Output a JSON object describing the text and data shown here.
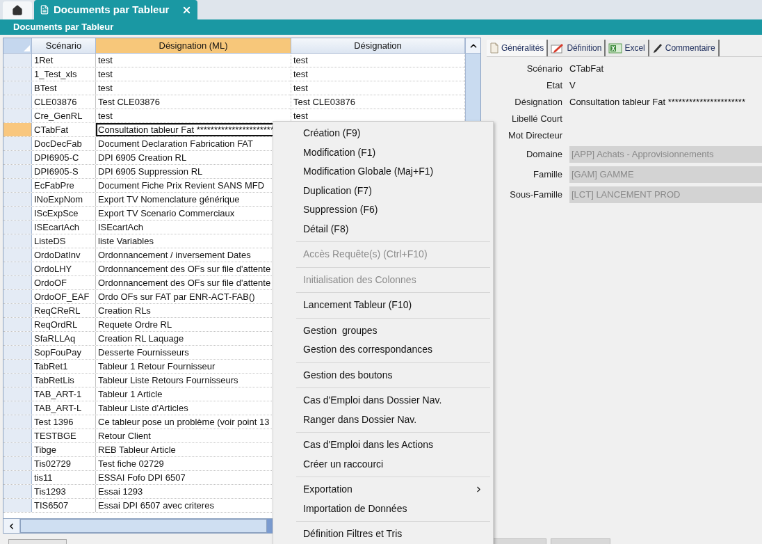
{
  "app_tabs": [
    {
      "kind": "home",
      "selected": false
    },
    {
      "kind": "document",
      "label": "Documents par Tableur",
      "selected": true
    }
  ],
  "title": "Documents par Tableur",
  "grid": {
    "columns": [
      {
        "label": "Scénario",
        "sorted": false
      },
      {
        "label": "Désignation (ML)",
        "sorted": true
      },
      {
        "label": "Désignation",
        "sorted": false
      }
    ],
    "rows": [
      {
        "scenario": "1Ret",
        "designation_ml": "test",
        "designation": "test",
        "selected": false
      },
      {
        "scenario": "1_Test_xls",
        "designation_ml": "test",
        "designation": "test",
        "selected": false
      },
      {
        "scenario": "BTest",
        "designation_ml": "test",
        "designation": "test",
        "selected": false
      },
      {
        "scenario": "CLE03876",
        "designation_ml": "Test CLE03876",
        "designation": "Test CLE03876",
        "selected": false
      },
      {
        "scenario": "Cre_GenRL",
        "designation_ml": "test",
        "designation": "test",
        "selected": false
      },
      {
        "scenario": "CTabFat",
        "designation_ml": "Consultation tableur Fat **********************",
        "selected": true
      },
      {
        "scenario": "DocDecFab",
        "designation_ml": "Document Declaration Fabrication FAT",
        "selected": false
      },
      {
        "scenario": "DPI6905-C",
        "designation_ml": "DPI 6905 Creation RL",
        "selected": false
      },
      {
        "scenario": "DPI6905-S",
        "designation_ml": "DPI 6905 Suppression RL",
        "selected": false
      },
      {
        "scenario": "EcFabPre",
        "designation_ml": "Document Fiche Prix Revient SANS MFD",
        "selected": false
      },
      {
        "scenario": "INoExpNom",
        "designation_ml": "Export TV Nomenclature générique",
        "selected": false
      },
      {
        "scenario": "IScExpSce",
        "designation_ml": "Export TV Scenario Commerciaux",
        "selected": false
      },
      {
        "scenario": "ISEcartAch",
        "designation_ml": "ISEcartAch",
        "selected": false
      },
      {
        "scenario": "ListeDS",
        "designation_ml": "liste Variables",
        "selected": false
      },
      {
        "scenario": "OrdoDatInv",
        "designation_ml": "Ordonnancement / inversement Dates",
        "selected": false
      },
      {
        "scenario": "OrdoLHY",
        "designation_ml": "Ordonnancement des OFs sur file d'attente",
        "selected": false
      },
      {
        "scenario": "OrdoOF",
        "designation_ml": "Ordonnancement des OFs sur file d'attente",
        "selected": false
      },
      {
        "scenario": "OrdoOF_EAF",
        "designation_ml": "Ordo OFs sur FAT par ENR-ACT-FAB()",
        "selected": false
      },
      {
        "scenario": "ReqCReRL",
        "designation_ml": "Creation RLs",
        "selected": false
      },
      {
        "scenario": "ReqOrdRL",
        "designation_ml": "Requete Ordre RL",
        "selected": false
      },
      {
        "scenario": "SfaRLLAq",
        "designation_ml": "Creation RL Laquage",
        "selected": false
      },
      {
        "scenario": "SopFouPay",
        "designation_ml": "Desserte Fournisseurs",
        "selected": false
      },
      {
        "scenario": "TabRet1",
        "designation_ml": "Tableur 1 Retour Fournisseur",
        "selected": false
      },
      {
        "scenario": "TabRetLis",
        "designation_ml": "Tableur Liste Retours Fournisseurs",
        "selected": false
      },
      {
        "scenario": "TAB_ART-1",
        "designation_ml": "Tableur 1 Article",
        "selected": false
      },
      {
        "scenario": "TAB_ART-L",
        "designation_ml": "Tableur Liste d'Articles",
        "selected": false
      },
      {
        "scenario": "Test 1396",
        "designation_ml": "Ce tableur pose un problème (voir point 13",
        "selected": false
      },
      {
        "scenario": "TESTBGE",
        "designation_ml": "Retour Client",
        "selected": false
      },
      {
        "scenario": "Tibge",
        "designation_ml": "REB Tableur Article",
        "selected": false
      },
      {
        "scenario": "Tis02729",
        "designation_ml": "Test fiche 02729",
        "selected": false
      },
      {
        "scenario": "tis11",
        "designation_ml": "ESSAI Fofo DPI 6507",
        "selected": false
      },
      {
        "scenario": "Tis1293",
        "designation_ml": "Essai 1293",
        "selected": false
      },
      {
        "scenario": "TIS6507",
        "designation_ml": "Essai DPI 6507 avec criteres",
        "selected": false
      }
    ]
  },
  "detail_tabs": [
    {
      "label": "Généralités",
      "selected": true
    },
    {
      "label": "Définition",
      "selected": false
    },
    {
      "label": "Excel",
      "selected": false
    },
    {
      "label": "Commentaire",
      "selected": false
    }
  ],
  "detail_fields": [
    {
      "kind": "text",
      "label": "Scénario",
      "value": "CTabFat"
    },
    {
      "kind": "text",
      "label": "Etat",
      "value": "V"
    },
    {
      "kind": "text",
      "label": "Désignation",
      "value": "Consultation tableur Fat **********************"
    },
    {
      "kind": "text",
      "label": "Libellé Court"
    },
    {
      "kind": "text",
      "label": "Mot Directeur"
    },
    {
      "kind": "select",
      "label": "Domaine",
      "value": "[APP] Achats - Approvisionnements",
      "disabled": true
    },
    {
      "kind": "select",
      "label": "Famille",
      "value": "[GAM] GAMME",
      "disabled": true
    },
    {
      "kind": "select",
      "label": "Sous-Famille",
      "value": "[LCT] LANCEMENT PROD",
      "disabled": true
    }
  ],
  "context_menu": {
    "groups": [
      [
        {
          "label": "Création (F9)",
          "disabled": false,
          "submenu": false
        },
        {
          "label": "Modification (F1)",
          "disabled": false,
          "submenu": false
        },
        {
          "label": "Modification Globale (Maj+F1)",
          "disabled": false,
          "submenu": false
        },
        {
          "label": "Duplication (F7)",
          "disabled": false,
          "submenu": false
        },
        {
          "label": "Suppression (F6)",
          "disabled": false,
          "submenu": false
        },
        {
          "label": "Détail (F8)",
          "disabled": false,
          "submenu": false
        }
      ],
      [
        {
          "label": "Accès Requête(s) (Ctrl+F10)",
          "disabled": true,
          "submenu": false
        }
      ],
      [
        {
          "label": "Initialisation des Colonnes",
          "disabled": true,
          "submenu": false
        }
      ],
      [
        {
          "label": "Lancement Tableur (F10)",
          "disabled": false,
          "submenu": false
        }
      ],
      [
        {
          "label": "Gestion  groupes",
          "disabled": false,
          "submenu": false
        },
        {
          "label": "Gestion des correspondances",
          "disabled": false,
          "submenu": false
        }
      ],
      [
        {
          "label": "Gestion des boutons",
          "disabled": false,
          "submenu": false
        }
      ],
      [
        {
          "label": "Cas d'Emploi dans Dossier Nav.",
          "disabled": false,
          "submenu": false
        },
        {
          "label": "Ranger dans Dossier Nav.",
          "disabled": false,
          "submenu": false
        }
      ],
      [
        {
          "label": "Cas d'Emploi dans les Actions",
          "disabled": false,
          "submenu": false
        },
        {
          "label": "Créer un raccourci",
          "disabled": false,
          "submenu": false
        }
      ],
      [
        {
          "label": "Exportation",
          "disabled": false,
          "submenu": true
        },
        {
          "label": "Importation de Données",
          "disabled": false,
          "submenu": false
        }
      ],
      [
        {
          "label": "Définition Filtres et Tris",
          "disabled": false,
          "submenu": false
        }
      ]
    ]
  }
}
